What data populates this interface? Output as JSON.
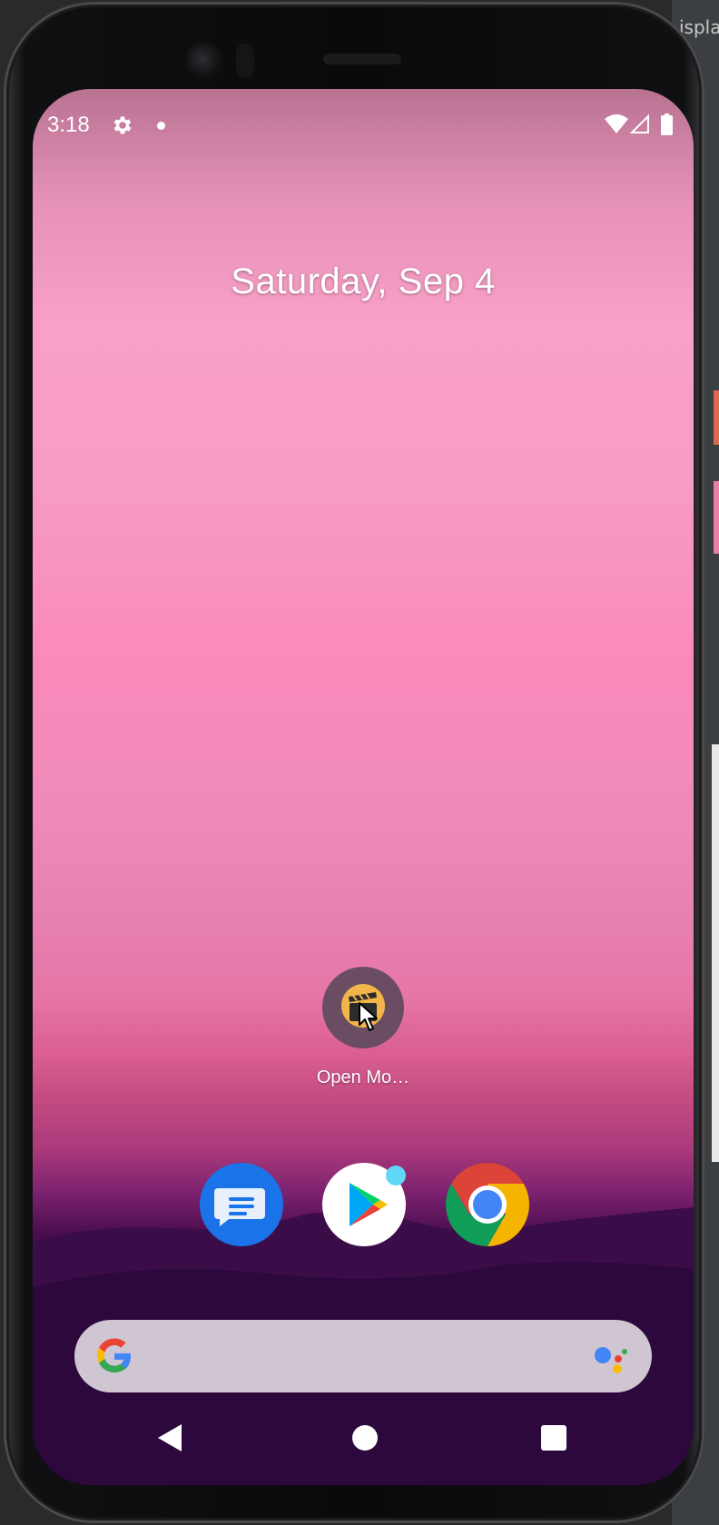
{
  "background_window": {
    "tab_label": "isplay"
  },
  "status_bar": {
    "time": "3:18",
    "icons": [
      "gear-icon",
      "dot-icon",
      "wifi-icon",
      "signal-icon",
      "battery-icon"
    ]
  },
  "home": {
    "date": "Saturday, Sep 4",
    "apps": [
      {
        "label": "Open Mo…",
        "icon": "clapperboard-icon"
      }
    ],
    "dock": [
      {
        "name": "Messages",
        "icon": "messages-icon"
      },
      {
        "name": "Play Store",
        "icon": "play-store-icon",
        "has_badge": true
      },
      {
        "name": "Chrome",
        "icon": "chrome-icon"
      }
    ]
  },
  "search_bar": {
    "icons": [
      "google-g-icon",
      "assistant-icon"
    ]
  },
  "nav_bar": {
    "buttons": [
      "back",
      "home",
      "recents"
    ]
  },
  "colors": {
    "wallpaper_top": "#f9a0c7",
    "wallpaper_bottom": "#230733",
    "messages_blue": "#1a73e8",
    "search_bar_bg": "#d0c6d2",
    "play_badge": "#62d7f7"
  }
}
